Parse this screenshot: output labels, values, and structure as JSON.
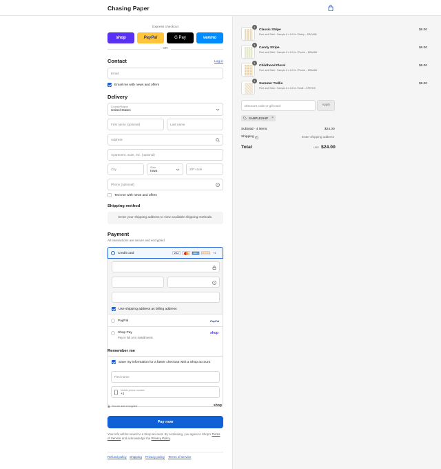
{
  "header": {
    "brand": "Chasing Paper",
    "bag_icon": "shopping-bag-icon"
  },
  "express": {
    "label": "Express checkout",
    "buttons": [
      {
        "label": "shop",
        "bg": "#5a31f4",
        "color": "#ffffff"
      },
      {
        "label": "PayPal",
        "bg": "#ffc439",
        "color": "#253b80"
      },
      {
        "label": "G Pay",
        "bg": "#000000",
        "color": "#ffffff"
      },
      {
        "label": "venmo",
        "bg": "#008cff",
        "color": "#ffffff"
      }
    ],
    "or": "OR"
  },
  "contact": {
    "title": "Contact",
    "login": "Log in",
    "email_placeholder": "Email",
    "news_label": "Email me with news and offers"
  },
  "delivery": {
    "title": "Delivery",
    "country_label": "Country/Region",
    "country_value": "United States",
    "first_name": "First name (optional)",
    "last_name": "Last name",
    "address": "Address",
    "apartment": "Apartment, suite, etc. (optional)",
    "city": "City",
    "state_label": "State",
    "state_value": "Iowa",
    "zip": "ZIP code",
    "phone": "Phone (optional)",
    "text_news": "Text me with news and offers"
  },
  "shipping": {
    "title": "Shipping method",
    "notice": "Enter your shipping address to view available shipping methods."
  },
  "payment": {
    "title": "Payment",
    "subtitle": "All transactions are secure and encrypted.",
    "credit_card": "Credit card",
    "card_brands": [
      {
        "label": "VISA",
        "bg": "#ffffff",
        "color": "#1a1f71"
      },
      {
        "label": "MC",
        "bg": "#ffffff",
        "color": "#eb001b"
      },
      {
        "label": "AMEX",
        "bg": "#2e77bc",
        "color": "#ffffff"
      },
      {
        "label": "DISCOVER",
        "bg": "#ffffff",
        "color": "#f58220"
      }
    ],
    "more_brands": "+4",
    "billing_same": "Use shipping address as billing address",
    "paypal": "PayPal",
    "paypal_logo": "PayPal",
    "shop_pay": "Shop Pay",
    "shop_pay_sub": "Pay in full or in installments",
    "shop_logo": "shop"
  },
  "remember": {
    "title": "Remember me",
    "save_label": "Save my information for a faster checkout with a Shop account",
    "first_name": "First name",
    "mobile_label": "Mobile phone number",
    "mobile_prefix": "+1",
    "secure": "Secure and encrypted",
    "shop_logo": "shop"
  },
  "pay_now": "Pay now",
  "legal": {
    "line1": "Your info will be saved to a Shop account. By continuing, you agree to Shop's",
    "terms": "Terms of Service",
    "middle": "and acknowledge the",
    "privacy": "Privacy Policy",
    "end": "."
  },
  "footer_links": [
    "Refund policy",
    "Shipping",
    "Privacy policy",
    "Terms of service"
  ],
  "cart": {
    "items": [
      {
        "name": "Classic Stripe",
        "desc": "Peel and Stick / Sample 8 x 8.5 in / Daisy – EBCA88",
        "price": "$6.00",
        "qty": "1",
        "swatch": "#e9dcbc"
      },
      {
        "name": "Candy Stripe",
        "desc": "Peel and Stick / Sample 8 x 8.5 in / Poolie – EBA488",
        "price": "$6.00",
        "qty": "1",
        "swatch": "#e6ead0"
      },
      {
        "name": "Childhood Floral",
        "desc": "Peel and Stick / Sample 8 x 8.5 in / Poolie – EBA488",
        "price": "$6.00",
        "qty": "1",
        "swatch": "#efe5cd"
      },
      {
        "name": "Summer Trellis",
        "desc": "Peel and Stick / Sample 8 x 8.5 in / Multi – EFE7D9",
        "price": "$6.00",
        "qty": "1",
        "swatch": "#e8dfc6"
      }
    ],
    "discount_placeholder": "Discount code or gift card",
    "apply": "Apply",
    "tag": "SAMPLESHIP",
    "subtotal_label": "Subtotal · 4 items",
    "subtotal_value": "$24.00",
    "shipping_label": "Shipping",
    "shipping_value": "Enter shipping address",
    "total_label": "Total",
    "currency": "USD",
    "total_value": "$24.00"
  }
}
